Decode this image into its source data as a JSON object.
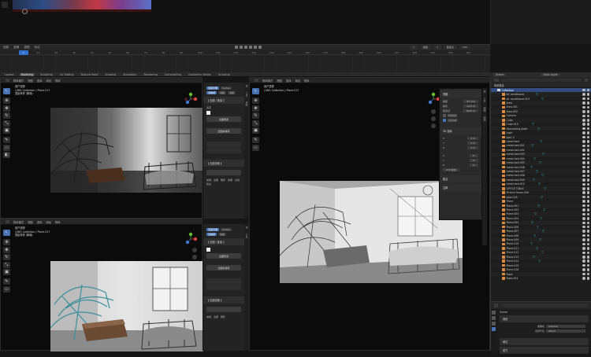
{
  "timeline": {
    "start_frame": "1",
    "header_items": [
      "回放",
      "抠像",
      "视图",
      "标记"
    ],
    "ticks": [
      "0",
      "10",
      "20",
      "30",
      "40",
      "50",
      "60",
      "70",
      "80",
      "90",
      "100",
      "110",
      "120",
      "130",
      "140",
      "150",
      "160",
      "170",
      "180",
      "190",
      "200",
      "210",
      "220",
      "230",
      "240",
      "250"
    ],
    "frame_fields": [
      "1",
      "起始",
      "1",
      "结束点",
      "250"
    ]
  },
  "workspaces": {
    "tabs": [
      "Layout",
      "Modeling",
      "Sculpting",
      "UV Editing",
      "Texture Paint",
      "Shading",
      "Animation",
      "Rendering",
      "Compositing",
      "Geometry Nodes",
      "Scripting"
    ],
    "active": "Modeling",
    "scene_label": "Scene",
    "view_layer_label": "View Layer"
  },
  "viewports": {
    "header_items": [
      "视图",
      "选择",
      "添加",
      "物体"
    ],
    "mode_label": "物体模式",
    "info_line1": "用户透视",
    "info_line2": "(166) Collection | Plane.017",
    "info_line3": "渲染采样 (降噪)"
  },
  "panel_tl": {
    "tab1": "渲染引擎",
    "tab2": "Cycles",
    "sub1": "当前帧",
    "sub2": "动画",
    "sub3": "渲染",
    "section1": "【 出图 / 批量 】",
    "btn_render": "出图预览",
    "btn_output": "出图并保存",
    "section2": "【 出图设置 】",
    "labels": [
      "宽高",
      "1",
      "2",
      "3",
      "4",
      "5"
    ],
    "checkbox_labels": [
      "常用",
      "全部",
      "阴影",
      "透明",
      "反射",
      "优先"
    ]
  },
  "panel_right": {
    "title": "视图",
    "rows": [
      [
        "焦距",
        "50 mm"
      ],
      [
        "裁切",
        "0.01 m"
      ],
      [
        "结束点",
        "1000 m"
      ]
    ],
    "local_camera": "局部相机",
    "render_region": "渲染边框",
    "transform_title": "3D 游标",
    "coords": [
      [
        "X",
        "0 m"
      ],
      [
        "Y",
        "0 m"
      ],
      [
        "Z",
        "0 m"
      ]
    ],
    "rotation": [
      [
        "X",
        "0°"
      ],
      [
        "Y",
        "0°"
      ],
      [
        "Z",
        "0°"
      ]
    ],
    "mode_label": "XYZ 欧拉",
    "collections": "集合",
    "annotations": "注释"
  },
  "outliner": {
    "header": "场景集合",
    "items": [
      {
        "name": "Collection",
        "type": "collection",
        "selected": true
      },
      {
        "name": "air conditioner",
        "type": "object"
      },
      {
        "name": "air conditioner.001",
        "type": "object"
      },
      {
        "name": "Area",
        "type": "object"
      },
      {
        "name": "Area.001",
        "type": "object"
      },
      {
        "name": "Area.002",
        "type": "object"
      },
      {
        "name": "Camera",
        "type": "object"
      },
      {
        "name": "Cube",
        "type": "object"
      },
      {
        "name": "Cube.010",
        "type": "object"
      },
      {
        "name": "Decoraring plate",
        "type": "object"
      },
      {
        "name": "Light",
        "type": "object"
      },
      {
        "name": "light 3",
        "type": "object"
      },
      {
        "name": "metal bed",
        "type": "object"
      },
      {
        "name": "metal bed.001",
        "type": "object"
      },
      {
        "name": "metal bed.002",
        "type": "object"
      },
      {
        "name": "metal bed.003",
        "type": "object"
      },
      {
        "name": "metal bed.004",
        "type": "object"
      },
      {
        "name": "metal bed.005",
        "type": "object"
      },
      {
        "name": "metal bed.006",
        "type": "object"
      },
      {
        "name": "metal bed.007",
        "type": "object"
      },
      {
        "name": "metal bed.008",
        "type": "object"
      },
      {
        "name": "metal bed.009",
        "type": "object"
      },
      {
        "name": "metal bed.010",
        "type": "object"
      },
      {
        "name": "OFFICE TABLE",
        "type": "object"
      },
      {
        "name": "Picture frame.006",
        "type": "object"
      },
      {
        "name": "pipe.018",
        "type": "object"
      },
      {
        "name": "Plane",
        "type": "object"
      },
      {
        "name": "Plane.001",
        "type": "object"
      },
      {
        "name": "Plane.002",
        "type": "object"
      },
      {
        "name": "Plane.003",
        "type": "object"
      },
      {
        "name": "Plane.004",
        "type": "object"
      },
      {
        "name": "Plane.005",
        "type": "object"
      },
      {
        "name": "Plane.006",
        "type": "object"
      },
      {
        "name": "Plane.007",
        "type": "object"
      },
      {
        "name": "Plane.008",
        "type": "object"
      },
      {
        "name": "Plane.009",
        "type": "object"
      },
      {
        "name": "Plane.010",
        "type": "object"
      },
      {
        "name": "Plane.011",
        "type": "object"
      },
      {
        "name": "Plane.012",
        "type": "object"
      },
      {
        "name": "Plane.013",
        "type": "object"
      },
      {
        "name": "Plane.014",
        "type": "object"
      },
      {
        "name": "Plane.015",
        "type": "object"
      },
      {
        "name": "Plane.016",
        "type": "object"
      },
      {
        "name": "Rope",
        "type": "object"
      },
      {
        "name": "Rope.001",
        "type": "object"
      }
    ]
  },
  "properties": {
    "tab_label": "Scene",
    "section": "场景",
    "camera_label": "摄像机",
    "camera_value": "Camera",
    "world_label": "世界环境",
    "world_value": "World",
    "units_section": "单位",
    "gravity_section": "重力"
  },
  "colors": {
    "accent": "#4772b3",
    "selection": "#334d80",
    "modifier": "#2dbfd0",
    "object": "#e08a3c"
  }
}
